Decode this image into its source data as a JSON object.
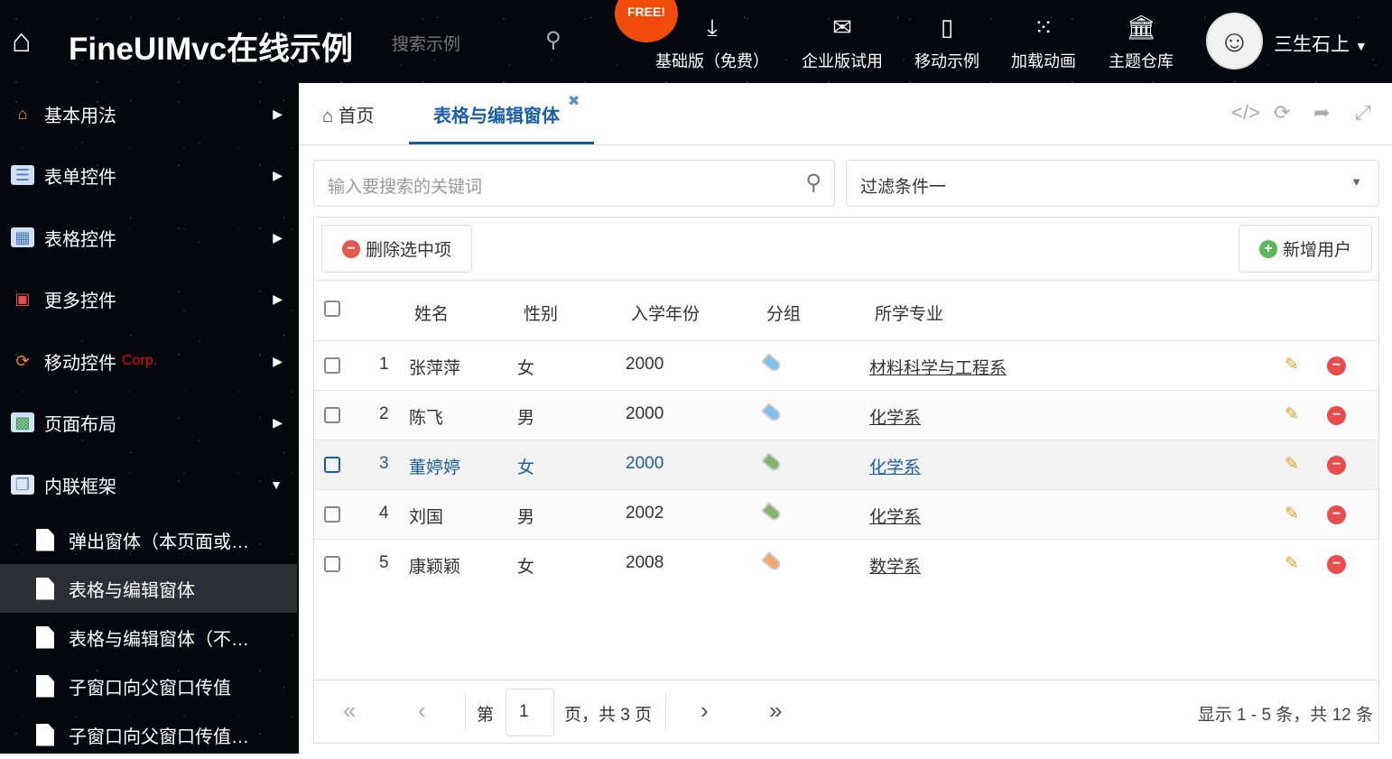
{
  "header": {
    "title": "FineUIMvc在线示例",
    "search_placeholder": "搜索示例",
    "free_badge": "FREE!",
    "nav": [
      {
        "label": "基础版（免费）",
        "icon": "download-icon"
      },
      {
        "label": "企业版试用",
        "icon": "envelope-icon"
      },
      {
        "label": "移动示例",
        "icon": "mobile-icon"
      },
      {
        "label": "加载动画",
        "icon": "spinner-icon"
      },
      {
        "label": "主题仓库",
        "icon": "bank-icon"
      }
    ],
    "user": "三生石上"
  },
  "sidebar": {
    "items": [
      {
        "label": "基本用法"
      },
      {
        "label": "表单控件"
      },
      {
        "label": "表格控件"
      },
      {
        "label": "更多控件"
      },
      {
        "label": "移动控件",
        "badge": "Corp."
      },
      {
        "label": "页面布局"
      },
      {
        "label": "内联框架"
      }
    ],
    "subitems": [
      "弹出窗体（本页面或…",
      "表格与编辑窗体",
      "表格与编辑窗体（不…",
      "子窗口向父窗口传值",
      "子窗口向父窗口传值…"
    ]
  },
  "tabs": {
    "home": "首页",
    "active": "表格与编辑窗体"
  },
  "search": {
    "placeholder": "输入要搜索的关键词"
  },
  "filter": {
    "selected": "过滤条件一"
  },
  "toolbar": {
    "delete": "删除选中项",
    "add": "新增用户"
  },
  "grid": {
    "columns": [
      "姓名",
      "性别",
      "入学年份",
      "分组",
      "所学专业"
    ],
    "rows": [
      {
        "no": "1",
        "name": "张萍萍",
        "gender": "女",
        "year": "2000",
        "tag": "#7cc0f0",
        "major": "材料科学与工程系"
      },
      {
        "no": "2",
        "name": "陈飞",
        "gender": "男",
        "year": "2000",
        "tag": "#7cc0f0",
        "major": "化学系"
      },
      {
        "no": "3",
        "name": "董婷婷",
        "gender": "女",
        "year": "2000",
        "tag": "#7fb56a",
        "major": "化学系"
      },
      {
        "no": "4",
        "name": "刘国",
        "gender": "男",
        "year": "2002",
        "tag": "#7fb56a",
        "major": "化学系"
      },
      {
        "no": "5",
        "name": "康颖颖",
        "gender": "女",
        "year": "2008",
        "tag": "#f5a86a",
        "major": "数学系"
      }
    ]
  },
  "pager": {
    "page_label": "第",
    "page": "1",
    "total_label": "页，共 3 页",
    "summary": "显示 1 - 5 条，共 12 条"
  }
}
